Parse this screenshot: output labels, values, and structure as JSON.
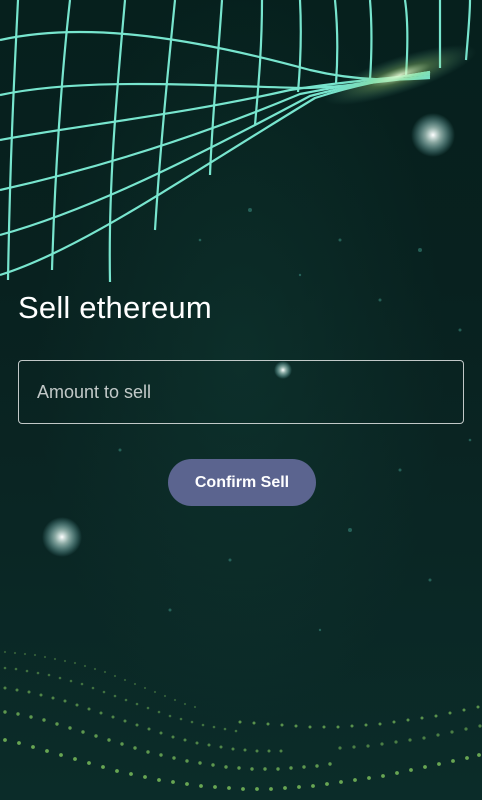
{
  "page": {
    "title": "Sell ethereum"
  },
  "form": {
    "amount_placeholder": "Amount to sell",
    "amount_value": "",
    "confirm_label": "Confirm Sell"
  },
  "colors": {
    "accent_button": "#5b648f",
    "grid_line": "#7ef0d8",
    "background": "#071716"
  }
}
